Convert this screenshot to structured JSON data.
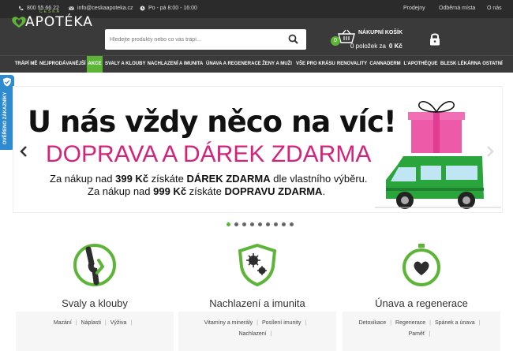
{
  "topbar": {
    "phone": "800 55 66 22",
    "email": "info@ceskaapoteka.cz",
    "hours": "Po - pá 8:00 - 16:00",
    "links": [
      "Prodejny",
      "Odběrná místa",
      "O nás"
    ]
  },
  "logo": {
    "sub": "ČESKÁ",
    "main": "APOTÉKA"
  },
  "search": {
    "placeholder": "Hledejte produkty nebo co vás trápí..."
  },
  "cart": {
    "count": "0",
    "title": "NÁKUPNÍ KOŠÍK",
    "items": "0 položek za",
    "total": "0 Kč"
  },
  "nav": [
    "TRÁPÍ MĚ",
    "NEJPRODÁVANĚJŠÍ",
    "AKCE",
    "SVALY A KLOUBY",
    "NACHLAZENÍ A IMUNITA",
    "ÚNAVA A REGENERACE",
    "ŽENY A MUŽI",
    "VŠE PRO KRÁSU",
    "RENOVALITY",
    "CANNADERM",
    "L'APOTHÉQUE",
    "BLESK LÉKÁRNA",
    "OSTATNÍ"
  ],
  "side_tab": {
    "label": "OVĚŘENO ZÁKAZNÍKY"
  },
  "banner": {
    "headline": "U nás vždy něco na víc!",
    "subheadline": "DOPRAVA A DÁREK ZDARMA",
    "line1_pre": "Za nákup nad ",
    "line1_amount": "399 Kč",
    "line1_mid": " získáte ",
    "line1_bold": "DÁREK ZDARMA",
    "line1_post": " dle vlastního výběru.",
    "line2_pre": "Za nákup nad ",
    "line2_amount": "999 Kč",
    "line2_mid": " získáte ",
    "line2_bold": "DOPRAVU ZDARMA",
    "line2_post": "."
  },
  "categories": [
    {
      "title": "Svaly a klouby",
      "icon": "knee-icon",
      "links": [
        "Mazání",
        "Náplasti",
        "Výživa"
      ]
    },
    {
      "title": "Nachlazení a imunita",
      "icon": "virus-shield-icon",
      "links": [
        "Vitamíny a minerály",
        "Posílení imunity",
        "Nachlazení"
      ]
    },
    {
      "title": "Únava a regenerace",
      "icon": "stopwatch-heart-icon",
      "links": [
        "Detoxikace",
        "Regenerace",
        "Spánek a únava",
        "Paměť"
      ]
    }
  ],
  "colors": {
    "accent": "#5cb536",
    "dark": "#3a3a3a",
    "pink": "#d4237a",
    "blue": "#2f8bd0"
  }
}
